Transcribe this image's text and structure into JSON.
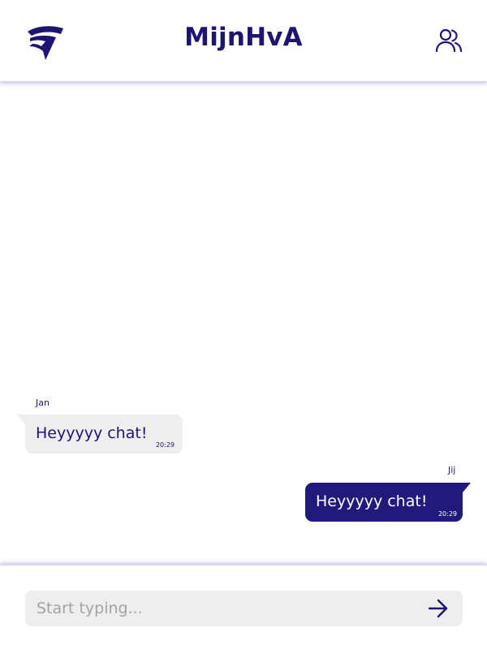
{
  "header": {
    "title": "MijnHvA",
    "logo_icon": "hva-logo-icon",
    "users_icon": "users-icon"
  },
  "messages": [
    {
      "sender": "Jan",
      "text": "Heyyyyy chat!",
      "time": "20:29",
      "direction": "incoming"
    },
    {
      "sender": "Jij",
      "text": "Heyyyyy chat!",
      "time": "20:29",
      "direction": "outgoing"
    }
  ],
  "composer": {
    "placeholder": "Start typing...",
    "value": "",
    "send_icon": "arrow-right-icon"
  },
  "colors": {
    "brand": "#1e1573",
    "outgoing_bubble": "#221a7a",
    "incoming_bubble": "#eeeeee",
    "input_background": "#eeeeee"
  }
}
